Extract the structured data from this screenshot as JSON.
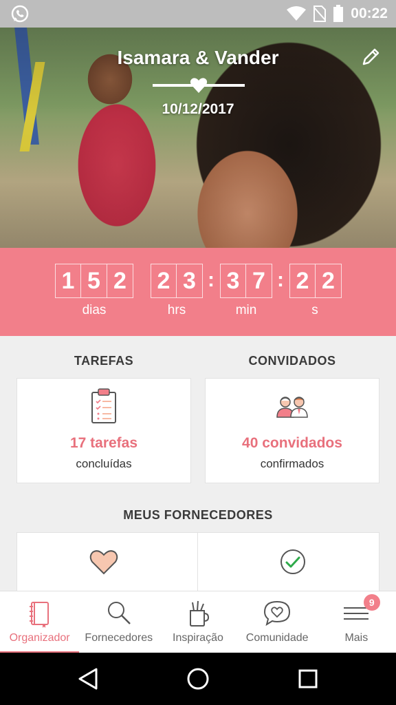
{
  "status_bar": {
    "time": "00:22"
  },
  "hero": {
    "couple_name": "Isamara & Vander",
    "wedding_date": "10/12/2017"
  },
  "countdown": {
    "days": [
      "1",
      "5",
      "2"
    ],
    "hours": [
      "2",
      "3"
    ],
    "minutes": [
      "3",
      "7"
    ],
    "seconds": [
      "2",
      "2"
    ],
    "labels": {
      "days": "dias",
      "hours": "hrs",
      "minutes": "min",
      "seconds": "s"
    }
  },
  "tasks": {
    "title": "TAREFAS",
    "count_text": "17 tarefas",
    "status_text": "concluídas"
  },
  "guests": {
    "title": "CONVIDADOS",
    "count_text": "40 convidados",
    "status_text": "confirmados"
  },
  "vendors": {
    "title": "MEUS FORNECEDORES"
  },
  "bottom_nav": {
    "items": [
      {
        "label": "Organizador",
        "icon": "notebook-icon",
        "active": true
      },
      {
        "label": "Fornecedores",
        "icon": "search-icon"
      },
      {
        "label": "Inspiração",
        "icon": "pencil-cup-icon"
      },
      {
        "label": "Comunidade",
        "icon": "chat-heart-icon"
      },
      {
        "label": "Mais",
        "icon": "menu-icon",
        "badge": "9"
      }
    ]
  },
  "colors": {
    "accent": "#f27f8a",
    "accent_text": "#e8707c",
    "status_bar": "#bdbdbd"
  }
}
